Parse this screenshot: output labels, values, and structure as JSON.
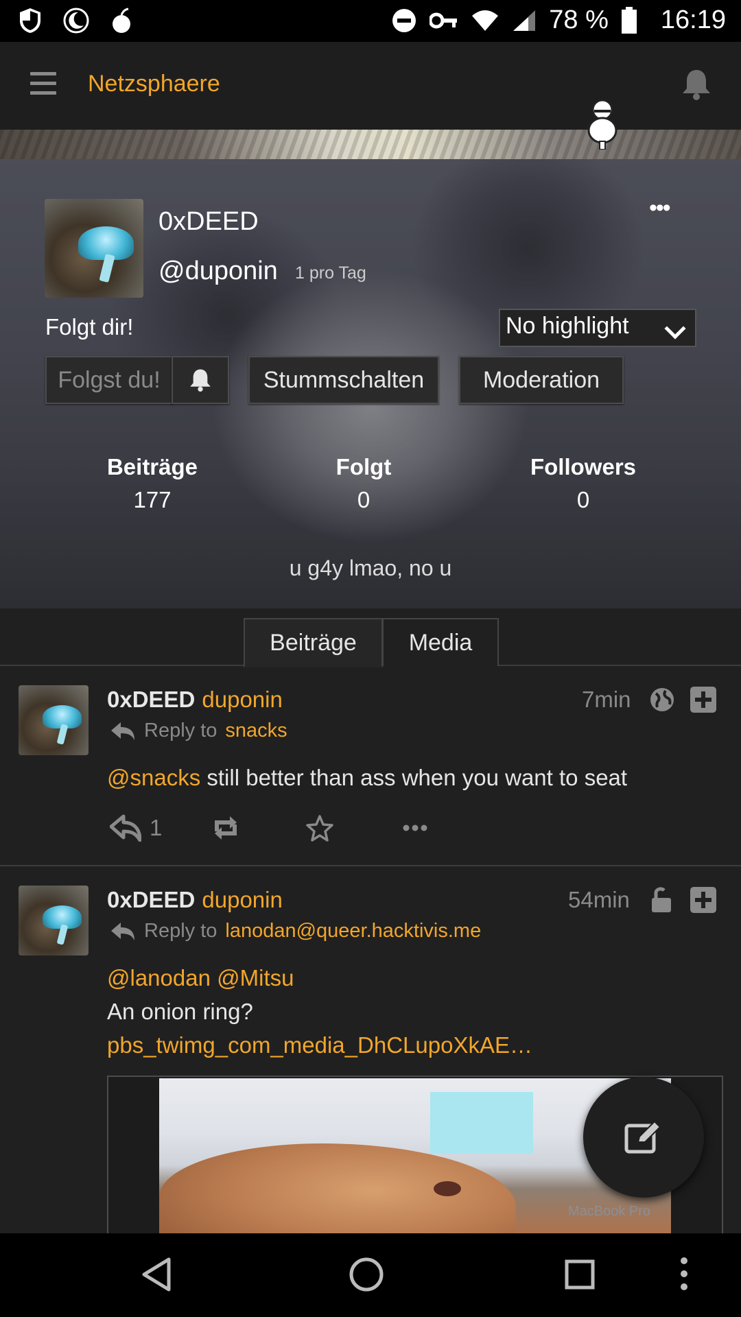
{
  "status_bar": {
    "battery": "78 %",
    "time": "16:19",
    "icons": [
      "shield-icon",
      "moon-icon",
      "bomb-icon",
      "dnd-icon",
      "key-icon",
      "wifi-icon",
      "signal-icon",
      "battery-icon"
    ]
  },
  "app_bar": {
    "title": "Netzsphaere",
    "icons": [
      "menu-icon",
      "notification-bell-icon"
    ]
  },
  "profile": {
    "display_name": "0xDEED",
    "handle": "@duponin",
    "post_rate": "1 pro Tag",
    "follows_you": "Folgt dir!",
    "highlight_select": {
      "selected": "No highlight"
    },
    "buttons": {
      "following": "Folgst du!",
      "mute": "Stummschalten",
      "moderation": "Moderation"
    },
    "stats": [
      {
        "label": "Beiträge",
        "value": "177"
      },
      {
        "label": "Folgt",
        "value": "0"
      },
      {
        "label": "Followers",
        "value": "0"
      }
    ],
    "bio": "u g4y lmao, no u"
  },
  "tabs": [
    {
      "label": "Beiträge",
      "active": true
    },
    {
      "label": "Media",
      "active": false
    }
  ],
  "posts": [
    {
      "name": "0xDEED",
      "user": "duponin",
      "time": "7min",
      "visibility_icon": "globe-icon",
      "reply_prefix": "Reply to",
      "reply_to": "snacks",
      "mention": "@snacks",
      "text": " still better than ass when you want to seat",
      "reply_count": "1"
    },
    {
      "name": "0xDEED",
      "user": "duponin",
      "time": "54min",
      "visibility_icon": "unlock-icon",
      "reply_prefix": "Reply to",
      "reply_to": "lanodan@queer.hacktivis.me",
      "mention1": "@lanodan",
      "mention2": "@Mitsu",
      "line2": "An onion ring?",
      "link": "pbs_twimg_com_media_DhCLupoXkAE…",
      "image_caption": "MacBook Pro"
    }
  ],
  "colors": {
    "accent": "#f2a62b",
    "background": "#202020",
    "app_bar": "#1e1e1e",
    "muted_text": "#8a8a8a"
  }
}
